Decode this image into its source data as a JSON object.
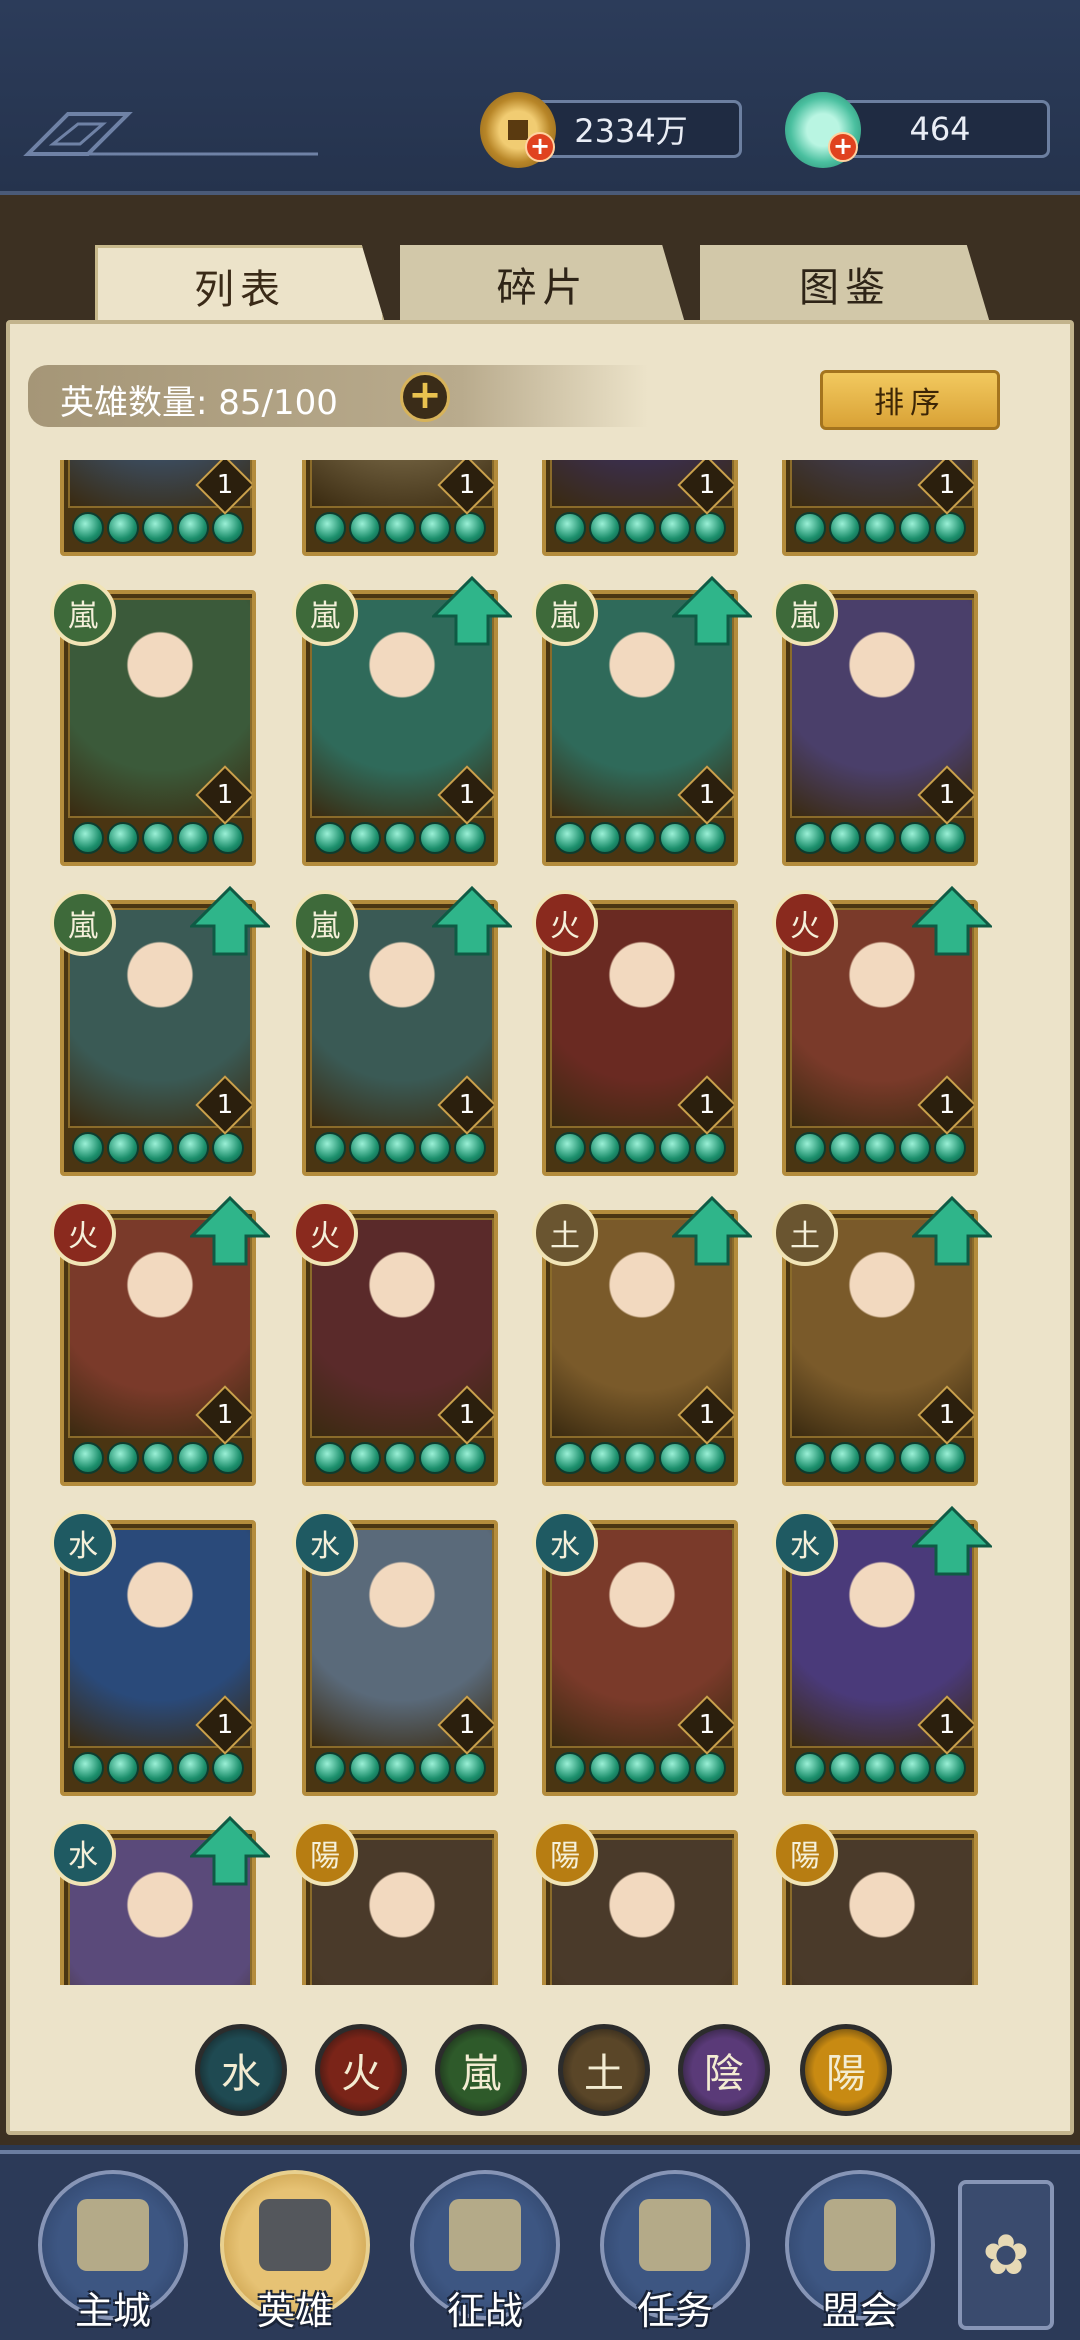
{
  "resources": {
    "coins": {
      "value": "2334万",
      "icon": "copper-coin-icon"
    },
    "jade": {
      "value": "464",
      "icon": "jade-shell-icon"
    }
  },
  "tabs": [
    {
      "label": "列表",
      "active": true
    },
    {
      "label": "碎片",
      "active": false
    },
    {
      "label": "图鉴",
      "active": false
    }
  ],
  "hero_count": {
    "label": "英雄数量: 85/100"
  },
  "sort_button": {
    "label": "排序"
  },
  "heroes": [
    {
      "element": "",
      "level": "1",
      "upgrade": false,
      "color": "#3b4a5a",
      "partial": true
    },
    {
      "element": "",
      "level": "1",
      "upgrade": false,
      "color": "#6a5a3a",
      "partial": true
    },
    {
      "element": "",
      "level": "1",
      "upgrade": false,
      "color": "#3a2e4a",
      "partial": true
    },
    {
      "element": "",
      "level": "1",
      "upgrade": false,
      "color": "#3f3a4a",
      "partial": true
    },
    {
      "element": "嵐",
      "level": "1",
      "upgrade": false,
      "color": "#3b5a3a"
    },
    {
      "element": "嵐",
      "level": "1",
      "upgrade": true,
      "color": "#2f6a5a"
    },
    {
      "element": "嵐",
      "level": "1",
      "upgrade": true,
      "color": "#2f6a5a"
    },
    {
      "element": "嵐",
      "level": "1",
      "upgrade": false,
      "color": "#4a3f6a"
    },
    {
      "element": "嵐",
      "level": "1",
      "upgrade": true,
      "color": "#3a5a55"
    },
    {
      "element": "嵐",
      "level": "1",
      "upgrade": true,
      "color": "#3a5a55"
    },
    {
      "element": "火",
      "level": "1",
      "upgrade": false,
      "color": "#6a2a22"
    },
    {
      "element": "火",
      "level": "1",
      "upgrade": true,
      "color": "#7a3a2a"
    },
    {
      "element": "火",
      "level": "1",
      "upgrade": true,
      "color": "#7a3a2a"
    },
    {
      "element": "火",
      "level": "1",
      "upgrade": false,
      "color": "#5a2a2a"
    },
    {
      "element": "土",
      "level": "1",
      "upgrade": true,
      "color": "#7a5a2a"
    },
    {
      "element": "土",
      "level": "1",
      "upgrade": true,
      "color": "#7a5a2a"
    },
    {
      "element": "水",
      "level": "1",
      "upgrade": false,
      "color": "#2a4a7a"
    },
    {
      "element": "水",
      "level": "1",
      "upgrade": false,
      "color": "#5a6a7a"
    },
    {
      "element": "水",
      "level": "1",
      "upgrade": false,
      "color": "#7a3a2a"
    },
    {
      "element": "水",
      "level": "1",
      "upgrade": true,
      "color": "#4a3a7a"
    },
    {
      "element": "水",
      "level": "",
      "upgrade": true,
      "color": "#5a4a7a",
      "cut": true
    },
    {
      "element": "陽",
      "level": "",
      "upgrade": false,
      "color": "#4a3a2a",
      "cut": true
    },
    {
      "element": "陽",
      "level": "",
      "upgrade": false,
      "color": "#4a3a2a",
      "cut": true
    },
    {
      "element": "陽",
      "level": "",
      "upgrade": false,
      "color": "#4a3a2a",
      "cut": true
    }
  ],
  "element_filters": [
    {
      "label": "水",
      "color": "#1f4a52"
    },
    {
      "label": "火",
      "color": "#7a2418"
    },
    {
      "label": "嵐",
      "color": "#2e5a2a"
    },
    {
      "label": "土",
      "color": "#5a4628"
    },
    {
      "label": "陰",
      "color": "#5a3a78"
    },
    {
      "label": "陽",
      "color": "#c88a12"
    }
  ],
  "element_colors": {
    "嵐": "#3e6a3a",
    "火": "#8a2a1e",
    "土": "#6a5530",
    "水": "#1f5a62",
    "陽": "#b77d12",
    "陰": "#5a3a78"
  },
  "nav": [
    {
      "label": "主城",
      "icon": "castle-icon",
      "active": false
    },
    {
      "label": "英雄",
      "icon": "hero-portrait-icon",
      "active": true
    },
    {
      "label": "征战",
      "icon": "scroll-battle-icon",
      "active": false
    },
    {
      "label": "任务",
      "icon": "quest-book-icon",
      "active": false
    },
    {
      "label": "盟会",
      "icon": "alliance-pavilion-icon",
      "active": false
    }
  ],
  "menu_button": {
    "icon": "menu-flower-icon"
  }
}
